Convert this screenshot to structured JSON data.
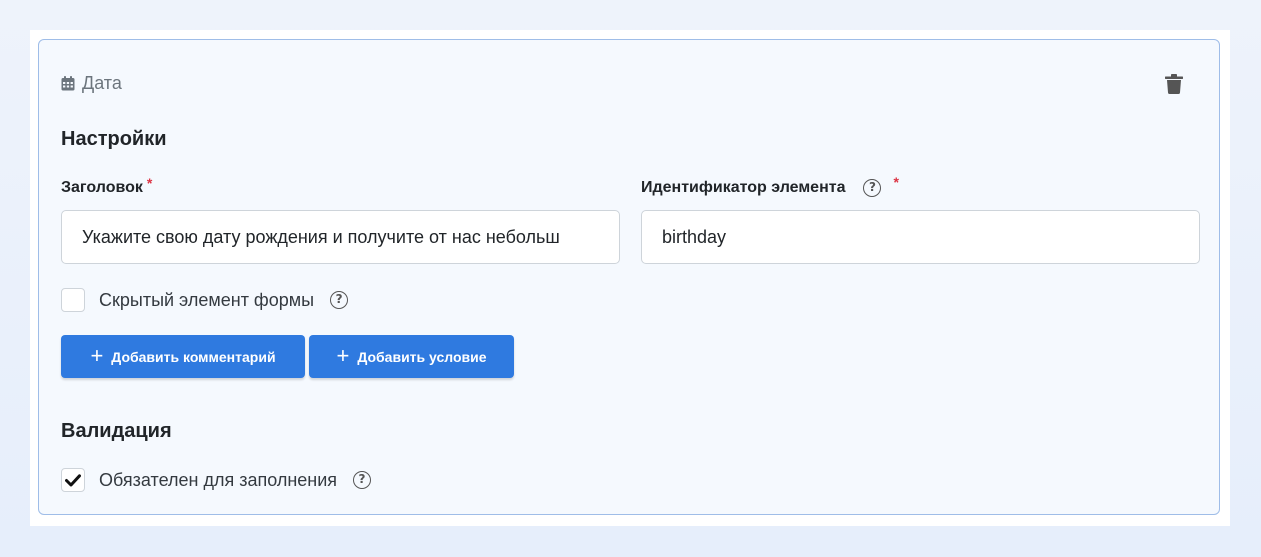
{
  "card": {
    "type_label": "Дата",
    "type_icon": "calendar-icon",
    "delete_icon": "trash-icon"
  },
  "settings": {
    "title": "Настройки",
    "title_field": {
      "label": "Заголовок",
      "required_mark": "*",
      "value": "Укажите свою дату рождения и получите от нас небольш"
    },
    "id_field": {
      "label": "Идентификатор элемента",
      "required_mark": "*",
      "help": "?",
      "value": "birthday"
    },
    "hidden": {
      "label": "Скрытый элемент формы",
      "help": "?",
      "checked": false
    },
    "buttons": {
      "add_comment": "Добавить комментарий",
      "add_condition": "Добавить условие",
      "plus": "+"
    }
  },
  "validation": {
    "title": "Валидация",
    "required": {
      "label": "Обязателен для заполнения",
      "help": "?",
      "checked": true
    }
  },
  "colors": {
    "accent": "#2f7ae0",
    "required": "#dc3545",
    "card_border": "#9fbde8",
    "card_bg": "#f5f9fe"
  }
}
